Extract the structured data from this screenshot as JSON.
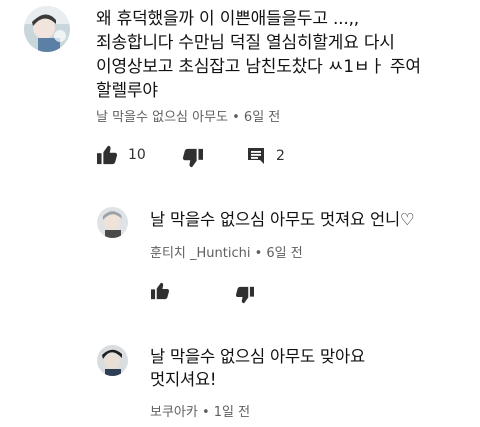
{
  "comments": [
    {
      "lines": [
        "왜 휴덕했을까 이 이쁜애들을두고 ...,,",
        "죄송합니다 수만님 덕질 열심히할게요 다시",
        "이영상보고 초심잡고 남친도찼다 ㅆ1ㅂㅏ 주여",
        "할렐루야"
      ],
      "meta": "날 막을수 없으심 아무도 • 6일 전",
      "like_count": "10",
      "reply_count": "2"
    }
  ],
  "replies": [
    {
      "text": "날 막을수 없으심 아무도 멋져요 언니♡",
      "meta": "훈티치 _Huntichi • 6일 전"
    },
    {
      "lines": [
        "날 막을수 없으심 아무도 맞아요",
        "멋지셔요!"
      ],
      "meta": "보쿠아카 • 1일 전"
    }
  ],
  "icons": {
    "like": "thumbs-up-icon",
    "dislike": "thumbs-down-icon",
    "reply": "comment-icon"
  },
  "colors": {
    "text": "#111111",
    "meta": "#606060",
    "icon": "#303030"
  }
}
